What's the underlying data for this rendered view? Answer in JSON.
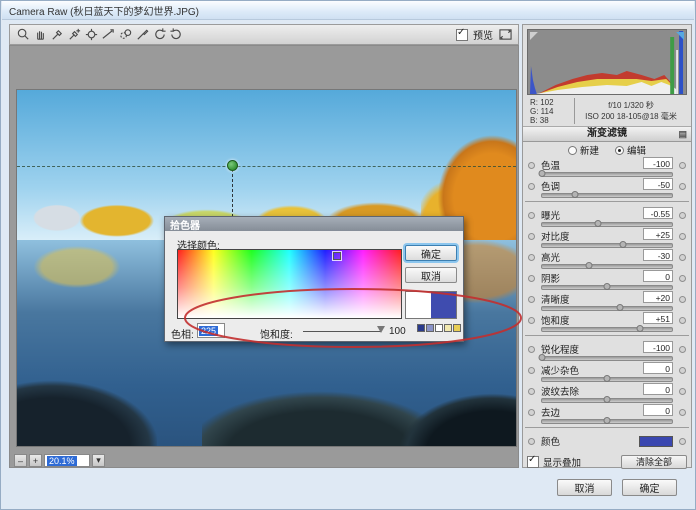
{
  "window": {
    "title": "Camera Raw (秋日蓝天下的梦幻世界.JPG)"
  },
  "toolbar": {
    "tools": [
      {
        "name": "zoom-tool",
        "icon": "zoom"
      },
      {
        "name": "hand-tool",
        "icon": "hand"
      },
      {
        "name": "white-balance-tool",
        "icon": "wb"
      },
      {
        "name": "color-sampler-tool",
        "icon": "sampler"
      },
      {
        "name": "targeted-adjustment-tool",
        "icon": "tat"
      },
      {
        "name": "straighten-tool",
        "icon": "straighten"
      },
      {
        "name": "spot-removal-tool",
        "icon": "spot"
      },
      {
        "name": "adjustment-brush-tool",
        "icon": "brush"
      },
      {
        "name": "rotate-left-tool",
        "icon": "rotl"
      },
      {
        "name": "rotate-right-tool",
        "icon": "rotr"
      }
    ],
    "preview_label": "预览",
    "preview_checked": true
  },
  "histogram": {
    "rgb": {
      "r": "R:  102",
      "g": "G:  114",
      "b": "B:  38"
    },
    "exif_line1": "f/10  1/320 秒",
    "exif_line2": "ISO 200  18-105@18 毫米"
  },
  "panel": {
    "title": "渐变滤镜",
    "radio_new": "新建",
    "radio_edit": "编辑",
    "radio_selected": "edit",
    "sliders": [
      {
        "key": "temperature",
        "label": "色温",
        "value": "-100",
        "pct": 0
      },
      {
        "key": "tint",
        "label": "色调",
        "value": "-50",
        "pct": 25
      },
      {
        "key": "exposure",
        "label": "曝光",
        "value": "-0.55",
        "pct": 43,
        "divider_before": true
      },
      {
        "key": "contrast",
        "label": "对比度",
        "value": "+25",
        "pct": 62
      },
      {
        "key": "highlights",
        "label": "高光",
        "value": "-30",
        "pct": 36
      },
      {
        "key": "shadows",
        "label": "阴影",
        "value": "0",
        "pct": 50
      },
      {
        "key": "clarity",
        "label": "清晰度",
        "value": "+20",
        "pct": 60
      },
      {
        "key": "saturation",
        "label": "饱和度",
        "value": "+51",
        "pct": 75
      },
      {
        "key": "sharpness",
        "label": "锐化程度",
        "value": "-100",
        "pct": 0,
        "divider_before": true
      },
      {
        "key": "noise-reduction",
        "label": "减少杂色",
        "value": "0",
        "pct": 50
      },
      {
        "key": "moire-reduction",
        "label": "波纹去除",
        "value": "0",
        "pct": 50
      },
      {
        "key": "defringe",
        "label": "去边",
        "value": "0",
        "pct": 50
      },
      {
        "key": "color",
        "label": "颜色",
        "type": "color",
        "swatch": "#3a47b0",
        "divider_before": true
      }
    ],
    "overlay_label": "显示叠加",
    "overlay_checked": true,
    "clear_all_label": "清除全部",
    "cancel_label": "取消",
    "ok_label": "确定"
  },
  "picker": {
    "title": "拾色器",
    "select_label": "选择颜色:",
    "ok_label": "确定",
    "cancel_label": "取消",
    "hue_label": "色相:",
    "hue_value": "225",
    "sat_label": "饱和度:",
    "sat_value": "100",
    "old_color": "#ffffff",
    "new_color": "#3f4caf",
    "mini_swatches": [
      "#2a3a8c",
      "#8a93c8",
      "#ffffff",
      "#f2e9b0",
      "#e9cf55"
    ]
  },
  "zoombar": {
    "minus": "–",
    "plus": "+",
    "level": "20.1%"
  },
  "colors": {
    "annotation": "#c22f2f",
    "pin": "#3f9c3f"
  }
}
